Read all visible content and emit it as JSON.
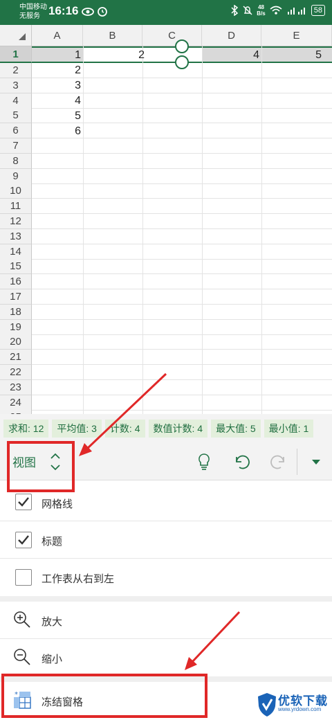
{
  "status_bar": {
    "carrier_line1": "中国移动",
    "carrier_line2": "无服务",
    "time": "16:16",
    "net_speed_value": "48",
    "net_speed_unit": "B/s",
    "battery": "58"
  },
  "grid": {
    "columns": [
      "A",
      "B",
      "C",
      "D",
      "E"
    ],
    "rows": [
      "1",
      "2",
      "3",
      "4",
      "5",
      "6",
      "7",
      "8",
      "9",
      "10",
      "11",
      "12",
      "13",
      "14",
      "15",
      "16",
      "17",
      "18",
      "19",
      "20",
      "21",
      "22",
      "23",
      "24",
      "25"
    ],
    "row1_values": {
      "A": "1",
      "B": "2",
      "D": "4",
      "E": "5"
    },
    "col_a_values": [
      "2",
      "3",
      "4",
      "5",
      "6"
    ]
  },
  "stats": [
    "求和: 12",
    "平均值: 3",
    "计数: 4",
    "数值计数: 4",
    "最大值: 5",
    "最小值: 1"
  ],
  "toolbar": {
    "tab_label": "视图"
  },
  "menu": {
    "gridlines_label": "网格线",
    "gridlines_checked": true,
    "headings_label": "标题",
    "headings_checked": true,
    "rtl_label": "工作表从右到左",
    "rtl_checked": false,
    "zoom_in_label": "放大",
    "zoom_out_label": "缩小",
    "freeze_label": "冻结窗格"
  },
  "colors": {
    "accent_green": "#217346",
    "annotation_red": "#e02828",
    "watermark_blue": "#1a63b7"
  },
  "watermark": {
    "title": "优软下载",
    "url": "www.yrdown.com"
  }
}
